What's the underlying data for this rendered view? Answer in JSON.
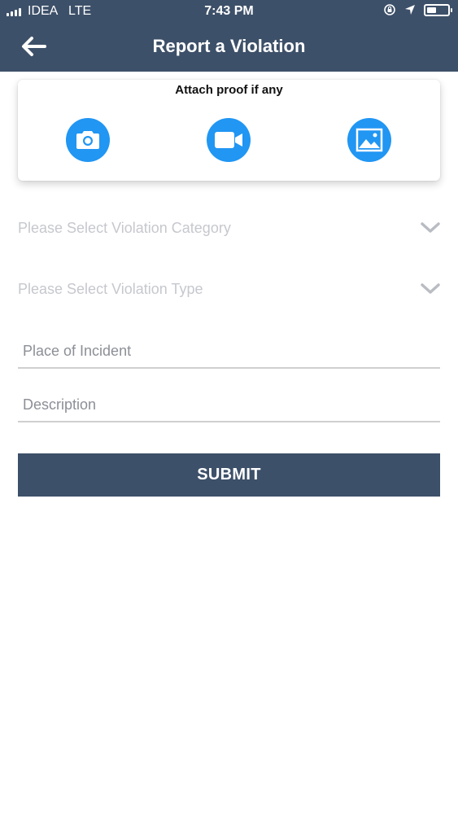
{
  "status_bar": {
    "carrier": "IDEA",
    "network": "LTE",
    "time": "7:43 PM"
  },
  "header": {
    "title": "Report a Violation",
    "back_icon": "arrow-left-icon",
    "background": "#3d5069"
  },
  "attach": {
    "title": "Attach proof if any",
    "buttons": [
      {
        "icon": "camera-icon"
      },
      {
        "icon": "video-icon"
      },
      {
        "icon": "image-icon"
      }
    ],
    "accent": "#2196f3"
  },
  "form": {
    "category_placeholder": "Please Select Violation Category",
    "type_placeholder": "Please Select Violation Type",
    "place_placeholder": "Place of Incident",
    "description_placeholder": "Description",
    "submit_label": "SUBMIT"
  }
}
